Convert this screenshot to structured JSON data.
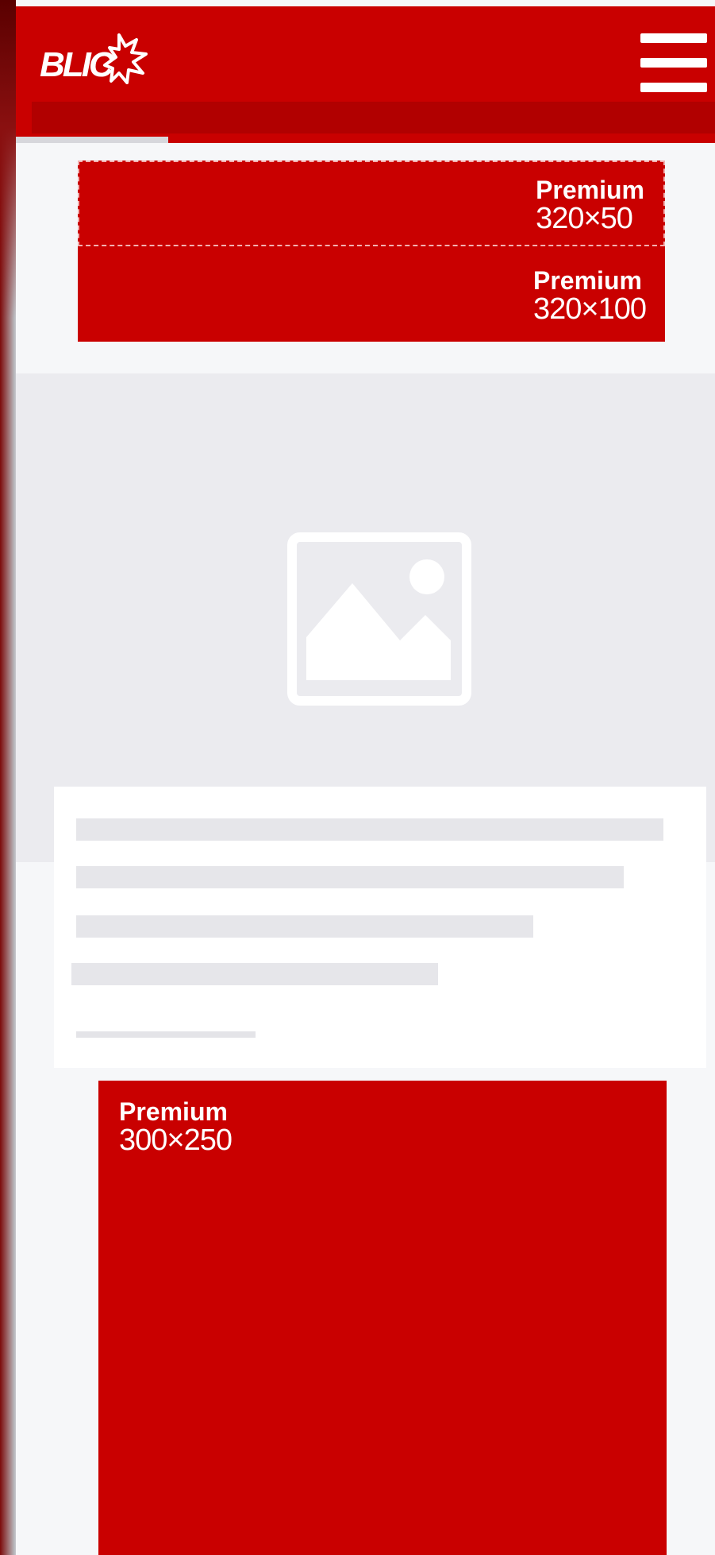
{
  "header": {
    "logo_text": "BLIC",
    "logo_icon": "blic-logo",
    "menu_icon": "hamburger-menu-icon",
    "background_color": "#c90000"
  },
  "ads": {
    "top_small": {
      "label": "Premium",
      "size": "320×50"
    },
    "top_large": {
      "label": "Premium",
      "size": "320×100"
    },
    "box": {
      "label": "Premium",
      "size": "300×250"
    }
  },
  "article_placeholder": {
    "image_icon": "image-placeholder-icon",
    "skeleton_lines": 5
  },
  "colors": {
    "brand_red": "#c90000",
    "placeholder_gray": "#ebebef",
    "skeleton_gray": "#e6e6ea",
    "page_background": "#f6f7f9"
  }
}
